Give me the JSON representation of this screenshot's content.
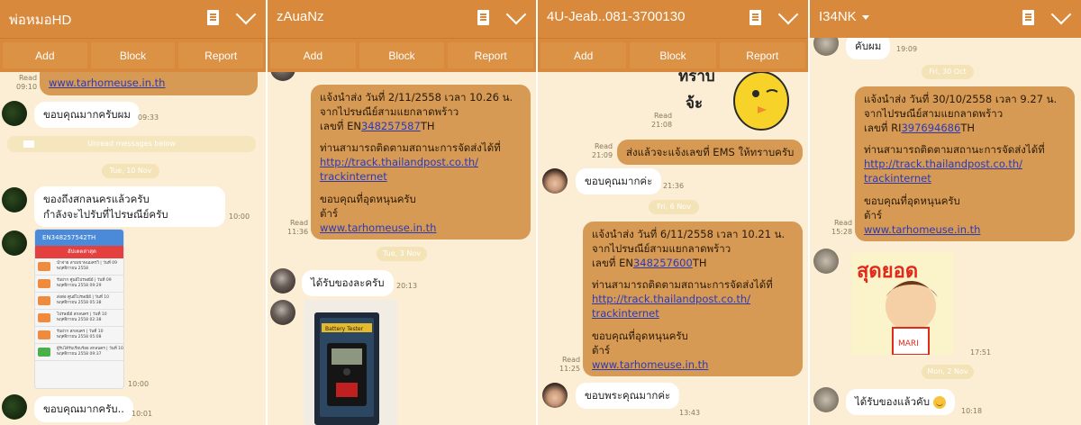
{
  "actions": {
    "add": "Add",
    "block": "Block",
    "report": "Report"
  },
  "panel1": {
    "title": "พ่อหมอHD",
    "read_label": "Read",
    "read_time": "09:10",
    "link_top": "www.tarhomeuse.in.th",
    "msg1": "ขอบคุณมากครับผม",
    "msg1_time": "09:33",
    "unread_label": "Unread messages below",
    "date1": "Tue, 10 Nov",
    "msg2_line1": "ของถึงสกลนครแล้วครับ",
    "msg2_line2": "กำลังจะไปรับที่ไปรษณีย์ครับ",
    "msg2_time": "10:00",
    "screenshot_header": "EN348257542TH",
    "screenshot_tab": "อัปเดตล่าสุด",
    "screenshot_rows": [
      "นำจ่าย สายเขาพนมครวิ | วันที่ 09 พฤศจิกายน 2558",
      "รับฝาก ศูนย์ไปรษณีย์ | วันที่ 09 พฤศจิกายน 2558 09:29",
      "ส่งต่อ ศูนย์ไปรษณีย์ | วันที่ 10 พฤศจิกายน 2558 05:38",
      "ไปรษณีย์ สกลนคร | วันที่ 10 พฤศจิกายน 2558 02:38",
      "รับฝาก สกลนคร | วันที่ 10 พฤศจิกายน 2558 05:08",
      "ผู้รับได้รับเรียบร้อย สกลนคร | วันที่ 10 พฤศจิกายน 2558 09:37"
    ],
    "screenshot_time": "10:00",
    "msg3": "ขอบคุณมากครับ..",
    "msg3_time": "10:01"
  },
  "panel2": {
    "title": "zAuaNz",
    "b1_l1": "แจ้งนำส่ง วันที่ 2/11/2558 เวลา 10.26 น.",
    "b1_l2": "จากไปรษณีย์สามแยกลาดพร้าว",
    "b1_l3_pre": "เลขที่ EN",
    "b1_l3_link": "348257587",
    "b1_l3_post": "TH",
    "b1_l4": "ท่านสามารถติดตามสถานะการจัดส่งได้ที่",
    "b1_l5": "http://track.thailandpost.co.th/",
    "b1_l6": "trackinternet",
    "b1_l7": "ขอบคุณที่อุดหนุนครับ",
    "b1_l8": "ต้าร์",
    "b1_l9": "www.tarhomeuse.in.th",
    "read_label": "Read",
    "read_time": "11:36",
    "date1": "Tue, 3 Nov",
    "msg1": "ได้รับของละครับ",
    "msg1_time": "20:13",
    "photo_label": "Battery Tester"
  },
  "panel3": {
    "title": "4U-Jeab..081-3700130",
    "sticker_text_1": "ทราบ",
    "sticker_text_2": "จ้ะ",
    "read_label": "Read",
    "read1_time": "21:08",
    "msg_ems": "ส่งแล้วจะแจ้งเลขที่ EMS ให้ทราบครับ",
    "read2_time": "21:09",
    "msg_thanks": "ขอบคุณมากค่ะ",
    "msg_thanks_time": "21:36",
    "date1": "Fri, 6 Nov",
    "b1_l1": "แจ้งนำส่ง วันที่ 6/11/2558 เวลา 10.21 น.",
    "b1_l2": "จากไปรษณีย์สามแยกลาดพร้าว",
    "b1_l3_pre": "เลขที่ EN",
    "b1_l3_link": "348257600",
    "b1_l3_post": "TH",
    "b1_l4": "ท่านสามารถติดตามสถานะการจัดส่งได้ที่",
    "b1_l5": "http://track.thailandpost.co.th/",
    "b1_l6": "trackinternet",
    "b1_l7": "ขอบคุณที่อุดหนุนครับ",
    "b1_l8": "ต้าร์",
    "b1_l9": "www.tarhomeuse.in.th",
    "read3_time": "11:25",
    "msg_last": "ขอบพระคุณมากค่ะ",
    "msg_last_time": "13:43"
  },
  "panel4": {
    "title": "I34NK",
    "msg_top": "คับผม",
    "msg_top_time": "19:09",
    "date1": "Fri, 30 Oct",
    "b1_l1": "แจ้งนำส่ง วันที่ 30/10/2558 เวลา 9.27 น.",
    "b1_l2": "จากไปรษณีย์สามแยกลาดพร้าว",
    "b1_l3_pre": "เลขที่ RI",
    "b1_l3_link": "397694686",
    "b1_l3_post": "TH",
    "b1_l4": "ท่านสามารถติดตามสถานะการจัดส่งได้ที่",
    "b1_l5": "http://track.thailandpost.co.th/",
    "b1_l6": "trackinternet",
    "b1_l7": "ขอบคุณที่อุดหนุนครับ",
    "b1_l8": "ต้าร์",
    "b1_l9": "www.tarhomeuse.in.th",
    "read_label": "Read",
    "read_time": "15:28",
    "sticker_text": "สุดยอด",
    "sticker_brand": "MARI",
    "sticker_time": "17:51",
    "date2": "Mon, 2 Nov",
    "msg_last": "ได้รับของแล้วคับ",
    "msg_last_time": "10:18"
  }
}
